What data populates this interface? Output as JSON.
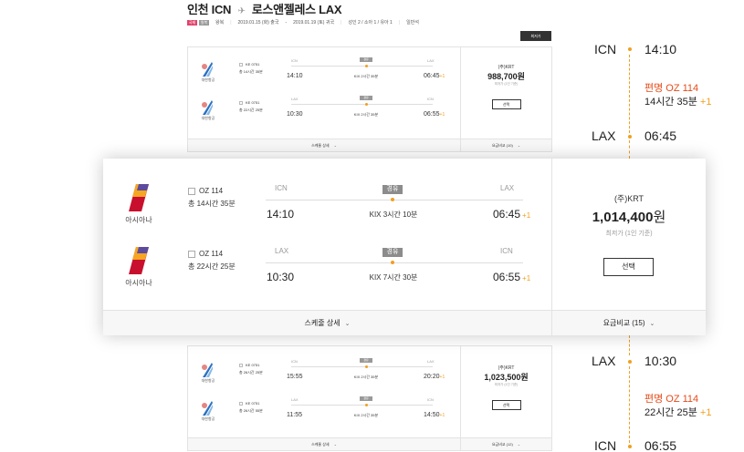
{
  "header": {
    "title_from": "인천 ICN",
    "title_to": "로스앤젤레스 LAX",
    "tag1": "국제",
    "tag2": "왕복",
    "trip_type": "왕복",
    "depart": "2019.01.15 (화) 출국",
    "return": "2019.01.19 (토) 귀국",
    "pax": "성인 2 / 소아 1 / 유아 1",
    "cabin": "일반석",
    "sort_button": "최저가"
  },
  "card_top": {
    "airline": "대한항공",
    "rows": [
      {
        "flight": "KE 0751",
        "total": "총 14시간 35분",
        "from": "ICN",
        "to": "LAX",
        "dep": "14:10",
        "arr": "06:45",
        "plus": "+1",
        "badge": "경유",
        "via": "KIX 2시간 35분"
      },
      {
        "flight": "KE 0751",
        "total": "총 22시간 25분",
        "from": "LAX",
        "to": "ICN",
        "dep": "10:30",
        "arr": "06:55",
        "plus": "+1",
        "badge": "경유",
        "via": "KIX 2시간 35분"
      }
    ],
    "currency": "(주)KRT",
    "price": "988,700원",
    "note": "최저가 (1인 기준)",
    "select": "선택",
    "schedule": "스케줄 상세",
    "fare_compare": "요금비교 (10)"
  },
  "card_focus": {
    "airline": "아시아나",
    "rows": [
      {
        "flight": "OZ 114",
        "total": "총 14시간 35분",
        "from": "ICN",
        "to": "LAX",
        "dep": "14:10",
        "arr": "06:45",
        "plus": "+1",
        "badge": "경유",
        "via": "KIX 3시간 10분"
      },
      {
        "flight": "OZ 114",
        "total": "총 22시간 25분",
        "from": "LAX",
        "to": "ICN",
        "dep": "10:30",
        "arr": "06:55",
        "plus": "+1",
        "badge": "경유",
        "via": "KIX 7시간 30분"
      }
    ],
    "currency": "(주)KRT",
    "price_num": "1,014,400",
    "price_unit": "원",
    "note": "최저가 (1인 기준)",
    "select": "선택",
    "schedule": "스케줄 상세",
    "fare_compare": "요금비교 (15)"
  },
  "card_bottom": {
    "airline": "대한항공",
    "rows": [
      {
        "flight": "KE 0751",
        "total": "총 26시간 25분",
        "from": "ICN",
        "to": "LAX",
        "dep": "15:55",
        "arr": "20:20",
        "plus": "+1",
        "badge": "경유",
        "via": "KIX 2시간 35분"
      },
      {
        "flight": "KE 0751",
        "total": "총 26시간 55분",
        "from": "LAX",
        "to": "ICN",
        "dep": "11:55",
        "arr": "14:50",
        "plus": "+1",
        "badge": "경유",
        "via": "KIX 2시간 35분"
      }
    ],
    "currency": "(주)KRT",
    "price": "1,023,500원",
    "note": "최저가 (1인 기준)",
    "select": "선택",
    "schedule": "스케줄 상세",
    "fare_compare": "요금비교 (12)"
  },
  "timeline": {
    "outbound": {
      "from_code": "ICN",
      "from_time": "14:10",
      "flight": "편명 OZ 114",
      "duration": "14시간 35분",
      "plus": "+1",
      "to_code": "LAX",
      "to_time": "06:45"
    },
    "inbound": {
      "from_code": "LAX",
      "from_time": "10:30",
      "flight": "편명 OZ 114",
      "duration": "22시간 25분",
      "plus": "+1",
      "to_code": "ICN",
      "to_time": "06:55"
    }
  },
  "colors": {
    "accent": "#f0a020",
    "flight_no": "#e64a19",
    "tag_red": "#e2426b"
  },
  "icons": {
    "plane": "airplane-icon",
    "chevron": "chevron-down-icon",
    "korean_air_logo": "korean-air-logo",
    "asiana_logo": "asiana-logo"
  }
}
